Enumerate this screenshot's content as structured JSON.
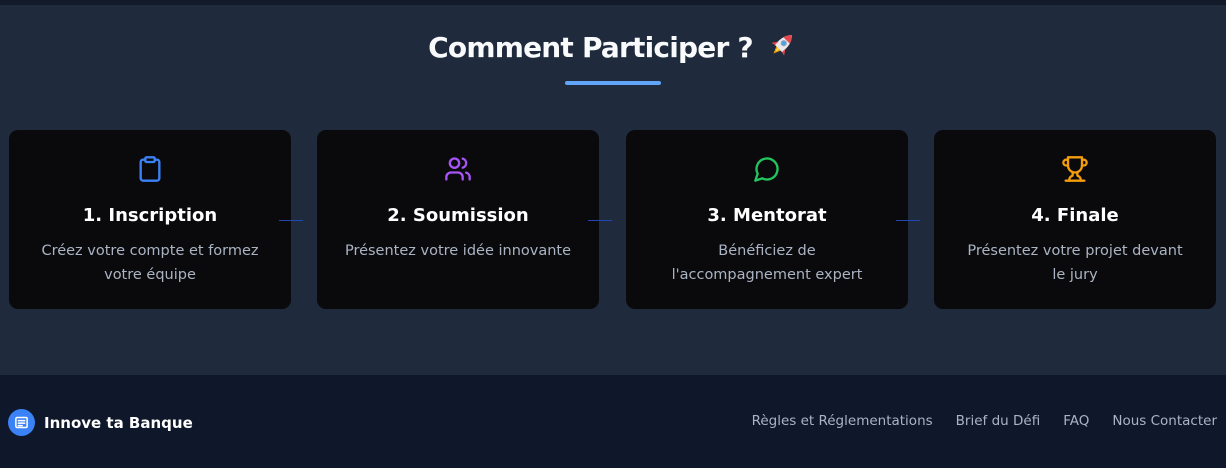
{
  "section": {
    "title": "Comment Participer ?",
    "title_emoji_icon": "rocket-icon"
  },
  "steps": [
    {
      "title": "1. Inscription",
      "description": "Créez votre compte et formez votre équipe",
      "icon": "clipboard-icon",
      "color": "#3b82f6"
    },
    {
      "title": "2. Soumission",
      "description": "Présentez votre idée innovante",
      "icon": "users-icon",
      "color": "#a855f7"
    },
    {
      "title": "3. Mentorat",
      "description": "Bénéficiez de l'accompagnement expert",
      "icon": "message-circle-icon",
      "color": "#22c55e"
    },
    {
      "title": "4. Finale",
      "description": "Présentez votre projet devant le jury",
      "icon": "trophy-icon",
      "color": "#f59e0b"
    }
  ],
  "colors": {
    "accent": "#60a5fa",
    "brand": "#3b82f6",
    "card_background": "#0a0a0d",
    "section_background": "#1f2a3c",
    "footer_background": "#0f172a"
  },
  "footer": {
    "brand_name": "Innove ta Banque",
    "brand_icon": "document-lines-icon",
    "links": [
      "Règles et Réglementations",
      "Brief du Défi",
      "FAQ",
      "Nous Contacter"
    ]
  }
}
